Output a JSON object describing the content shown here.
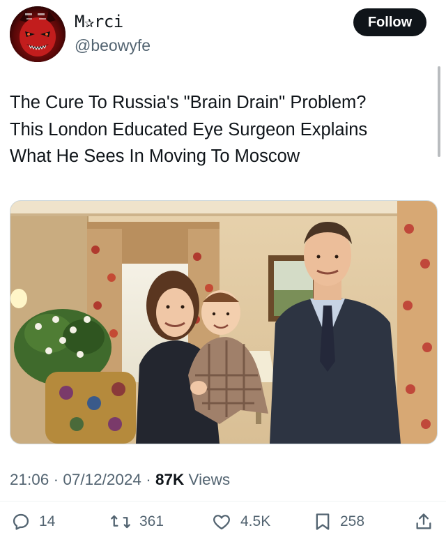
{
  "author": {
    "display_name": "M✰rci",
    "handle": "@beowyfe",
    "avatar_icon": "devil-face-avatar"
  },
  "follow_button": {
    "label": "Follow"
  },
  "tweet": {
    "lines": [
      "The Cure To Russia's \"Brain Drain\" Problem?",
      "This London Educated Eye Surgeon Explains",
      "What He Sees In Moving To Moscow"
    ]
  },
  "media": {
    "kind": "photo",
    "subjects": [
      "woman",
      "baby",
      "man"
    ]
  },
  "meta": {
    "time": "21:06",
    "separator": " · ",
    "date": "07/12/2024",
    "views_count": "87K",
    "views_label": " Views"
  },
  "actions": {
    "replies": "14",
    "reposts": "361",
    "likes": "4.5K",
    "bookmarks": "258"
  },
  "colors": {
    "primary_text": "#0f1419",
    "secondary_text": "#536471",
    "follow_bg": "#0f1419",
    "divider": "#eff3f4"
  }
}
